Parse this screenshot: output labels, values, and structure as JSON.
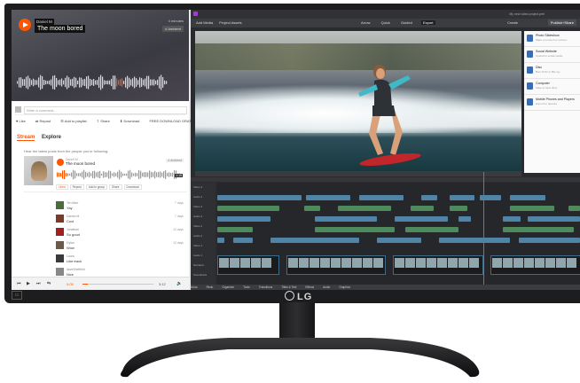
{
  "music_app": {
    "artist_tag": "Daniel M",
    "track_title": "The moon bored",
    "hero_meta": "4 minutes",
    "hero_tag": "# Ambient",
    "comment_placeholder": "Write a comment...",
    "actions": [
      "Like",
      "Repost",
      "Add to playlist",
      "Share",
      "Download"
    ],
    "free_download": "FREE DOWNLOAD GRATIS",
    "stats": "336,180  ▶ 2,961",
    "tabs": {
      "stream": "Stream",
      "explore": "Explore"
    },
    "subtitle": "Hear the latest posts from the people you're following:",
    "card": {
      "user": "Daniel M",
      "title": "The moon bored",
      "tag": "# Ambient",
      "count": "1:15",
      "actions": [
        "Liked",
        "Repost",
        "Add to group",
        "Share",
        "Download"
      ],
      "like_color": "#ff5500"
    },
    "comments": [
      {
        "name": "Ten Marr",
        "text": "Yay",
        "time": "7 days",
        "color": "#4a6b3a"
      },
      {
        "name": "Darwin M",
        "text": "Cool",
        "time": "7 days",
        "color": "#7a3a2a"
      },
      {
        "name": "Jonathan",
        "text": "So good",
        "time": "13 days",
        "color": "#a02020"
      },
      {
        "name": "Dylan",
        "text": "Wow",
        "time": "13 days",
        "color": "#6a5a4a"
      },
      {
        "name": "Laura",
        "text": "Like track",
        "time": "",
        "color": "#3a3a3a"
      },
      {
        "name": "daveSheffield",
        "text": "Nice",
        "time": "",
        "color": "#888888"
      }
    ],
    "player": {
      "time": "0:05",
      "duration": "3:12",
      "progress": 0.08
    }
  },
  "editor": {
    "menu": [
      "Add Media",
      "Project Assets"
    ],
    "tabs": [
      "Arrow",
      "Quick",
      "Guided",
      "Export"
    ],
    "active_tab": "Export",
    "project_name": "My new video project.prel",
    "create": "Create",
    "publish": "Publish+Share",
    "inspector": [
      {
        "title": "Photo Slideshow",
        "sub": "Make a movie from photos"
      },
      {
        "title": "Social Website",
        "sub": "Upload to social media"
      },
      {
        "title": "Disc",
        "sub": "Burn DVD or Blu-ray"
      },
      {
        "title": "Computer",
        "sub": "Save to hard drive"
      },
      {
        "title": "Mobile Phones and Players",
        "sub": "Export for devices"
      }
    ],
    "track_labels": [
      "Video 4",
      "Audio 4",
      "Video 3",
      "Audio 3",
      "Video 2",
      "Audio 2",
      "Video 1",
      "Audio 1",
      "Narration",
      "Soundtrack"
    ],
    "bottom_bar": [
      "Undo",
      "Redo",
      "Organizer",
      "Tools",
      "Transitions",
      "Titles & Text",
      "Effects",
      "Audio",
      "Graphics"
    ]
  },
  "brand": {
    "logo": "LG"
  }
}
